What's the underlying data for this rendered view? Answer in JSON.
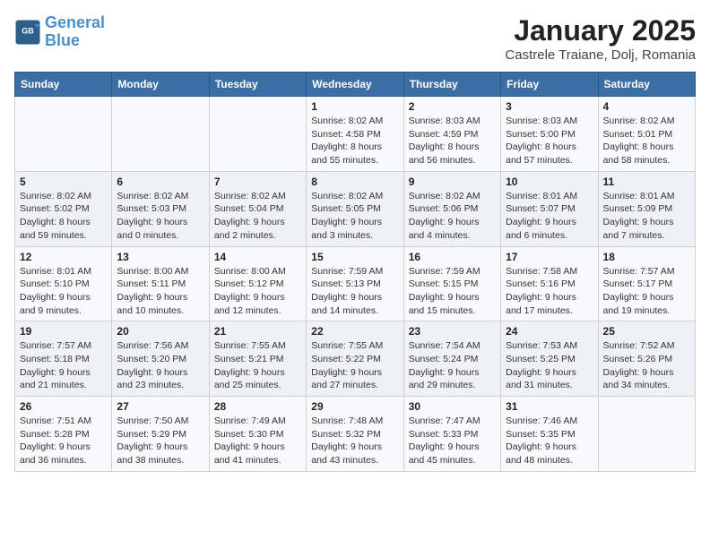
{
  "header": {
    "logo_line1": "General",
    "logo_line2": "Blue",
    "month_title": "January 2025",
    "location": "Castrele Traiane, Dolj, Romania"
  },
  "days_of_week": [
    "Sunday",
    "Monday",
    "Tuesday",
    "Wednesday",
    "Thursday",
    "Friday",
    "Saturday"
  ],
  "weeks": [
    [
      {
        "num": "",
        "info": ""
      },
      {
        "num": "",
        "info": ""
      },
      {
        "num": "",
        "info": ""
      },
      {
        "num": "1",
        "info": "Sunrise: 8:02 AM\nSunset: 4:58 PM\nDaylight: 8 hours\nand 55 minutes."
      },
      {
        "num": "2",
        "info": "Sunrise: 8:03 AM\nSunset: 4:59 PM\nDaylight: 8 hours\nand 56 minutes."
      },
      {
        "num": "3",
        "info": "Sunrise: 8:03 AM\nSunset: 5:00 PM\nDaylight: 8 hours\nand 57 minutes."
      },
      {
        "num": "4",
        "info": "Sunrise: 8:02 AM\nSunset: 5:01 PM\nDaylight: 8 hours\nand 58 minutes."
      }
    ],
    [
      {
        "num": "5",
        "info": "Sunrise: 8:02 AM\nSunset: 5:02 PM\nDaylight: 8 hours\nand 59 minutes."
      },
      {
        "num": "6",
        "info": "Sunrise: 8:02 AM\nSunset: 5:03 PM\nDaylight: 9 hours\nand 0 minutes."
      },
      {
        "num": "7",
        "info": "Sunrise: 8:02 AM\nSunset: 5:04 PM\nDaylight: 9 hours\nand 2 minutes."
      },
      {
        "num": "8",
        "info": "Sunrise: 8:02 AM\nSunset: 5:05 PM\nDaylight: 9 hours\nand 3 minutes."
      },
      {
        "num": "9",
        "info": "Sunrise: 8:02 AM\nSunset: 5:06 PM\nDaylight: 9 hours\nand 4 minutes."
      },
      {
        "num": "10",
        "info": "Sunrise: 8:01 AM\nSunset: 5:07 PM\nDaylight: 9 hours\nand 6 minutes."
      },
      {
        "num": "11",
        "info": "Sunrise: 8:01 AM\nSunset: 5:09 PM\nDaylight: 9 hours\nand 7 minutes."
      }
    ],
    [
      {
        "num": "12",
        "info": "Sunrise: 8:01 AM\nSunset: 5:10 PM\nDaylight: 9 hours\nand 9 minutes."
      },
      {
        "num": "13",
        "info": "Sunrise: 8:00 AM\nSunset: 5:11 PM\nDaylight: 9 hours\nand 10 minutes."
      },
      {
        "num": "14",
        "info": "Sunrise: 8:00 AM\nSunset: 5:12 PM\nDaylight: 9 hours\nand 12 minutes."
      },
      {
        "num": "15",
        "info": "Sunrise: 7:59 AM\nSunset: 5:13 PM\nDaylight: 9 hours\nand 14 minutes."
      },
      {
        "num": "16",
        "info": "Sunrise: 7:59 AM\nSunset: 5:15 PM\nDaylight: 9 hours\nand 15 minutes."
      },
      {
        "num": "17",
        "info": "Sunrise: 7:58 AM\nSunset: 5:16 PM\nDaylight: 9 hours\nand 17 minutes."
      },
      {
        "num": "18",
        "info": "Sunrise: 7:57 AM\nSunset: 5:17 PM\nDaylight: 9 hours\nand 19 minutes."
      }
    ],
    [
      {
        "num": "19",
        "info": "Sunrise: 7:57 AM\nSunset: 5:18 PM\nDaylight: 9 hours\nand 21 minutes."
      },
      {
        "num": "20",
        "info": "Sunrise: 7:56 AM\nSunset: 5:20 PM\nDaylight: 9 hours\nand 23 minutes."
      },
      {
        "num": "21",
        "info": "Sunrise: 7:55 AM\nSunset: 5:21 PM\nDaylight: 9 hours\nand 25 minutes."
      },
      {
        "num": "22",
        "info": "Sunrise: 7:55 AM\nSunset: 5:22 PM\nDaylight: 9 hours\nand 27 minutes."
      },
      {
        "num": "23",
        "info": "Sunrise: 7:54 AM\nSunset: 5:24 PM\nDaylight: 9 hours\nand 29 minutes."
      },
      {
        "num": "24",
        "info": "Sunrise: 7:53 AM\nSunset: 5:25 PM\nDaylight: 9 hours\nand 31 minutes."
      },
      {
        "num": "25",
        "info": "Sunrise: 7:52 AM\nSunset: 5:26 PM\nDaylight: 9 hours\nand 34 minutes."
      }
    ],
    [
      {
        "num": "26",
        "info": "Sunrise: 7:51 AM\nSunset: 5:28 PM\nDaylight: 9 hours\nand 36 minutes."
      },
      {
        "num": "27",
        "info": "Sunrise: 7:50 AM\nSunset: 5:29 PM\nDaylight: 9 hours\nand 38 minutes."
      },
      {
        "num": "28",
        "info": "Sunrise: 7:49 AM\nSunset: 5:30 PM\nDaylight: 9 hours\nand 41 minutes."
      },
      {
        "num": "29",
        "info": "Sunrise: 7:48 AM\nSunset: 5:32 PM\nDaylight: 9 hours\nand 43 minutes."
      },
      {
        "num": "30",
        "info": "Sunrise: 7:47 AM\nSunset: 5:33 PM\nDaylight: 9 hours\nand 45 minutes."
      },
      {
        "num": "31",
        "info": "Sunrise: 7:46 AM\nSunset: 5:35 PM\nDaylight: 9 hours\nand 48 minutes."
      },
      {
        "num": "",
        "info": ""
      }
    ]
  ]
}
